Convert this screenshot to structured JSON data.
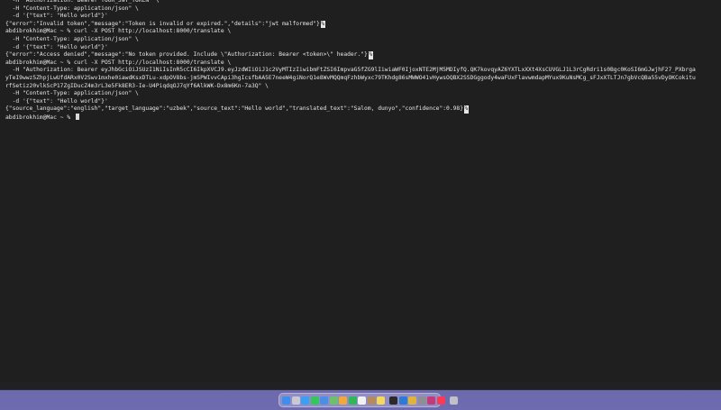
{
  "terminal": {
    "lines": [
      "  -H \"Authorization: Bearer YOUR_JWT_TOKEN\" \\",
      "  -H \"Content-Type: application/json\" \\",
      "  -d '{\"text\": \"Hello world\"}'",
      "{\"error\":\"Invalid token\",\"message\":\"Token is invalid or expired.\",\"details\":\"jwt malformed\"}",
      "abdibrokhim@Mac ~ % curl -X POST http://localhost:8000/translate \\",
      "  -H \"Content-Type: application/json\" \\",
      "  -d '{\"text\": \"Hello world\"}'",
      "{\"error\":\"Access denied\",\"message\":\"No token provided. Include \\\"Authorization: Bearer <token>\\\" header.\"}",
      "abdibrokhim@Mac ~ % curl -X POST http://localhost:8000/translate \\",
      "  -H \"Authorization: Bearer eyJhbGciOiJSUzI1NiIsInR5cCI6IkpXVCJ9.eyJzdWIiOiJ1c2VyMTIzIiwibmFtZSI6ImpvaG5fZG9lIiwiaWF0IjoxNTE2MjM5MDIyfQ.QK7kovqyAZ6YXTLxXXt4XsCUVGLJ1L3rCgRdri1s0Bgc0KoSI6mGJwjhF27_PXbrga",
      "yTeI9wwz5ZhpjLwUfdARx0V2Swv1mxhe0iawdKsxDTLu-xdpOV8bs-jmSPWIvvCApi3hgIcsfbAA5E7neeW4giNorQ1e8WvMQQmqFzhbWyxc79TKhdg86sMWWO41vHywsOQBX2SSDGggody4waFUxFlavwmdapMYux9KuNsMCg_sFJxXTLTJn7gbVcQBa55vDyOKCokitu",
      "rfSetiz20vlkScP17ZgIDucZ4m3rL3e5Fk8ER3-Ie-U4PiqdqOJ7qYf6AlkWK-Dx8m6Kn-7a3Q\" \\",
      "  -H \"Content-Type: application/json\" \\",
      "  -d '{\"text\": \"Hello world\"}'",
      "{\"source_language\":\"english\",\"target_language\":\"uzbek\",\"source_text\":\"Hello world\",\"translated_text\":\"Salom, dunyo\",\"confidence\":0.98}"
    ],
    "line_end_marks": [
      "",
      "",
      "",
      "%",
      "",
      "",
      "",
      "%",
      "",
      "",
      "",
      "",
      "",
      "",
      "%"
    ],
    "prompt": "abdibrokhim@Mac ~ % "
  },
  "dock": {
    "icons": [
      {
        "name": "finder-icon",
        "color": "#3d8ef0"
      },
      {
        "name": "launchpad-icon",
        "color": "#c9c9d6"
      },
      {
        "name": "safari-icon",
        "color": "#3aa0f5"
      },
      {
        "name": "messages-icon",
        "color": "#34c759"
      },
      {
        "name": "mail-icon",
        "color": "#4a8fe7"
      },
      {
        "name": "maps-icon",
        "color": "#6cc26c"
      },
      {
        "name": "photos-icon",
        "color": "#f2a93b"
      },
      {
        "name": "facetime-icon",
        "color": "#2fb857"
      },
      {
        "name": "calendar-icon",
        "color": "#f2f2f2"
      },
      {
        "name": "contacts-icon",
        "color": "#b38b5d"
      },
      {
        "name": "notes-icon",
        "color": "#f6d95b"
      },
      {
        "name": "terminal-icon",
        "color": "#2a2a2a"
      },
      {
        "name": "vscode-icon",
        "color": "#2b7bd6"
      },
      {
        "name": "chrome-icon",
        "color": "#e0b43a"
      },
      {
        "name": "settings-icon",
        "color": "#8e8e93"
      },
      {
        "name": "slack-icon",
        "color": "#c23a7a"
      },
      {
        "name": "music-icon",
        "color": "#fa3a55"
      },
      {
        "name": "trash-icon",
        "color": "#bfc0c8"
      }
    ]
  }
}
